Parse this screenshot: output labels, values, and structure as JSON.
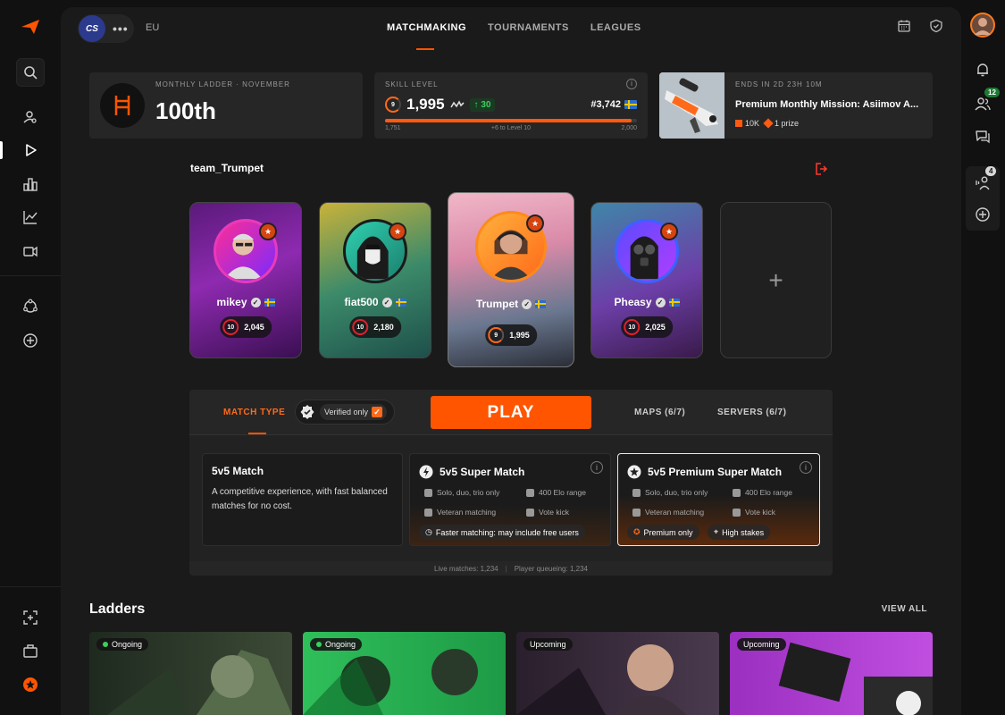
{
  "topbar": {
    "game": "CS",
    "region": "EU",
    "nav": [
      "MATCHMAKING",
      "TOURNAMENTS",
      "LEAGUES"
    ]
  },
  "ladder_card": {
    "label": "MONTHLY LADDER · NOVEMBER",
    "rank": "100th"
  },
  "skill_card": {
    "label": "SKILL LEVEL",
    "info": "i",
    "level": "9",
    "elo": "1,995",
    "trend": "30",
    "position": "#3,742",
    "progress_fraction": 0.98,
    "range_min": "1,751",
    "range_mid": "+6 to Level 10",
    "range_max": "2,000"
  },
  "mission_card": {
    "ends": "ENDS IN 2D 23H 10M",
    "title": "Premium Monthly Mission: Asiimov A...",
    "reward": "10K",
    "prize": "1 prize"
  },
  "team": {
    "name": "team_Trumpet",
    "players": [
      {
        "name": "mikey",
        "level": "10",
        "elo": "2,045"
      },
      {
        "name": "fiat500",
        "level": "10",
        "elo": "2,180"
      },
      {
        "name": "Trumpet",
        "level": "9",
        "elo": "1,995"
      },
      {
        "name": "Pheasy",
        "level": "10",
        "elo": "2,025"
      }
    ],
    "add_slot": "+"
  },
  "matchmaking": {
    "tab_match_type": "MATCH TYPE",
    "verified_only": "Verified only",
    "play": "PLAY",
    "tab_maps": "MAPS (6/7)",
    "tab_servers": "SERVERS (6/7)",
    "cards": [
      {
        "title": "5v5 Match",
        "desc": "A competitive experience, with fast balanced matches for no cost."
      },
      {
        "title": "5v5 Super Match",
        "f1": "Solo, duo, trio only",
        "f2": "400 Elo range",
        "f3": "Veteran matching",
        "f4": "Vote kick",
        "chip1": "Faster matching: may include free users"
      },
      {
        "title": "5v5 Premium Super Match",
        "f1": "Solo, duo, trio only",
        "f2": "400 Elo range",
        "f3": "Veteran matching",
        "f4": "Vote kick",
        "chip1": "Premium only",
        "chip2": "High stakes"
      }
    ],
    "live_matches": "Live matches: 1,234",
    "player_queueing": "Player queueing: 1,234"
  },
  "ladders": {
    "title": "Ladders",
    "view_all": "VIEW ALL",
    "cards": [
      {
        "status": "Ongoing"
      },
      {
        "status": "Ongoing"
      },
      {
        "status": "Upcoming"
      },
      {
        "status": "Upcoming"
      }
    ]
  },
  "right_rail": {
    "friends_badge": "12",
    "party_badge": "4"
  },
  "colors": {
    "accent": "#ff5500",
    "background": "#111111",
    "panel": "#1a1a1a",
    "positive": "#3ccf5e"
  }
}
